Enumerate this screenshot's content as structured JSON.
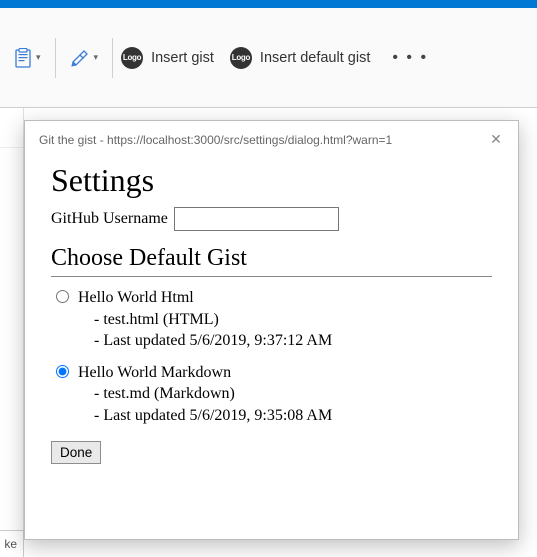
{
  "ribbon": {
    "insert_gist_label": "Insert gist",
    "insert_default_gist_label": "Insert default gist",
    "logo_text": "Logo",
    "ellipsis": "• • •"
  },
  "tab_edge_text": "ke",
  "dialog": {
    "titlebar": "Git the gist - https://localhost:3000/src/settings/dialog.html?warn=1",
    "heading": "Settings",
    "username_label": "GitHub Username",
    "username_value": "",
    "choose_heading": "Choose Default Gist",
    "gists": [
      {
        "selected": false,
        "title": "Hello World Html",
        "file_line": "- test.html (HTML)",
        "updated_line": "- Last updated 5/6/2019, 9:37:12 AM"
      },
      {
        "selected": true,
        "title": "Hello World Markdown",
        "file_line": "- test.md (Markdown)",
        "updated_line": "- Last updated 5/6/2019, 9:35:08 AM"
      }
    ],
    "done_label": "Done"
  }
}
